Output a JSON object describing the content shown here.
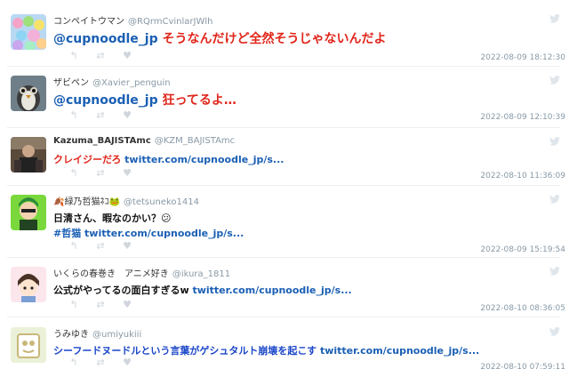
{
  "tweets": [
    {
      "user": "コンペイトウマン",
      "handle": "@RQrmCvinlarJWlh",
      "text_mention": "@cupnoodle_jp",
      "text_rest": " そうなんだけど全然そうじゃないんだよ",
      "timestamp": "2022-08-09 18:12:30"
    },
    {
      "user": "ザビペン",
      "handle": "@Xavier_penguin",
      "text_mention": "@cupnoodle_jp",
      "text_rest": " 狂ってるよ…",
      "timestamp": "2022-08-09 12:10:39"
    },
    {
      "user": "Kazuma_BAJISTAmc",
      "handle": "@KZM_BAJISTAmc",
      "text_main": "クレイジーだろ",
      "text_link": " twitter.com/cupnoodle_jp/s...",
      "timestamp": "2022-08-10 11:36:09"
    },
    {
      "user": "🍂緑乃哲猫ﾈｺ🐸",
      "handle": "@tetsuneko1414",
      "text_main": "日清さん、暇なのかい？😕",
      "text_line2_tag": "#哲猫",
      "text_line2_link": " twitter.com/cupnoodle_jp/s...",
      "timestamp": "2022-08-09 15:19:54"
    },
    {
      "user": "いくらの春巻き　アニメ好き",
      "handle": "@ikura_1811",
      "text_main": "公式がやってるの面白すぎるw",
      "text_link": " twitter.com/cupnoodle_jp/s...",
      "timestamp": "2022-08-10 08:36:05"
    },
    {
      "user": "うみゆき",
      "handle": "@umiyukiii",
      "text_main": "シーフードヌードルという言葉がゲシュタルト崩壊を起こす",
      "text_link": " twitter.com/cupnoodle_jp/s...",
      "timestamp": "2022-08-10 07:59:11"
    }
  ],
  "actions": {
    "reply": "↰",
    "retweet": "⇄",
    "like": "♥"
  },
  "colors": {
    "mention": "#1a5fb4",
    "red": "#e0261b",
    "muted": "#8899a6",
    "bird": "#dfe6ec"
  }
}
